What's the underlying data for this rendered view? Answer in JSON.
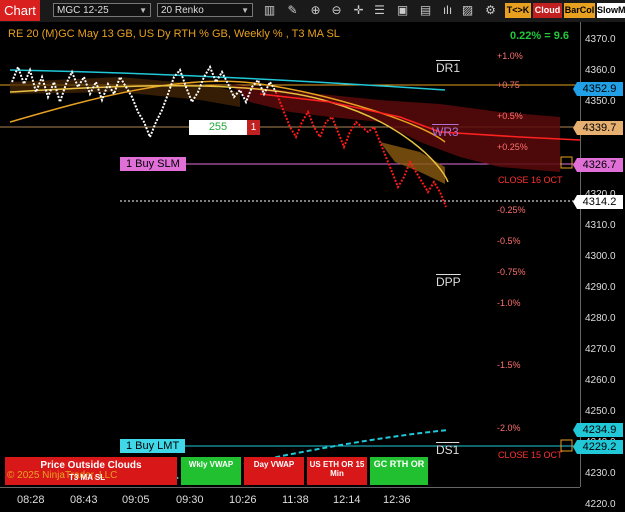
{
  "toolbar": {
    "tab_label": "Chart",
    "instrument": "MGC 12-25",
    "bartype": "20 Renko",
    "tco_label": "T<>K",
    "cloud_label": "Cloud",
    "barcol_label": "BarCol",
    "slowm_label": "SlowM"
  },
  "chart": {
    "title": "RE 20  (M)GC May 13 GB, US Dy RTH % GB, Weekly % , T3 MA SL",
    "pct_change": "0.22% = 9.6",
    "y_ticks": [
      "4370.0",
      "4360.0",
      "4350.0",
      "4340.0",
      "4330.0",
      "4320.0",
      "4310.0",
      "4300.0",
      "4290.0",
      "4280.0",
      "4270.0",
      "4260.0",
      "4250.0",
      "4240.0",
      "4230.0",
      "4220.0"
    ],
    "x_ticks": [
      "08:28",
      "08:43",
      "09:05",
      "09:30",
      "10:26",
      "11:38",
      "12:14",
      "12:36"
    ],
    "price_tags": [
      {
        "value": "4352.9",
        "color": "#21a0e8"
      },
      {
        "value": "4339.7",
        "color": "#e8b070"
      },
      {
        "value": "4326.7",
        "color": "#e070d8"
      },
      {
        "value": "4314.2",
        "color": "#ffffff"
      },
      {
        "value": "4234.9",
        "color": "#20c8d8"
      },
      {
        "value": "4229.2",
        "color": "#20c8d8"
      }
    ],
    "pct_levels": [
      {
        "label": "+1.0%",
        "color": "#ff6060"
      },
      {
        "label": "+0.75",
        "color": "#ff6060"
      },
      {
        "label": "+0.5%",
        "color": "#ff6060"
      },
      {
        "label": "+0.25%",
        "color": "#ff6060"
      },
      {
        "label": "-0.25%",
        "color": "#ff6060"
      },
      {
        "label": "-0.5%",
        "color": "#ff6060"
      },
      {
        "label": "-0.75%",
        "color": "#ff6060"
      },
      {
        "label": "-1.0%",
        "color": "#ff6060"
      },
      {
        "label": "-1.5%",
        "color": "#ff6060"
      },
      {
        "label": "-2.0%",
        "color": "#ff6060"
      }
    ],
    "levels": {
      "dr1": "DR1",
      "wr3": "WR3",
      "dpp": "DPP",
      "ds1": "DS1"
    },
    "close_16": "CLOSE 16 OCT",
    "close_15": "CLOSE 15 OCT",
    "order_buy_slm": "1 Buy SLM",
    "order_buy_lmt": "1 Buy LMT",
    "qty_value": "255",
    "qty_count": "1",
    "close_marker": "X"
  },
  "buttons": {
    "price_outside": "Price Outside Clouds",
    "copyright": "© 2025 NinjaTrader, LLC",
    "t3ma": "T3 MA SL",
    "wkly_vwap": "Wkly VWAP",
    "day_vwap": "Day VWAP",
    "us_eth": "US ETH OR 15 Min",
    "gc_rth": "GC RTH OR"
  }
}
